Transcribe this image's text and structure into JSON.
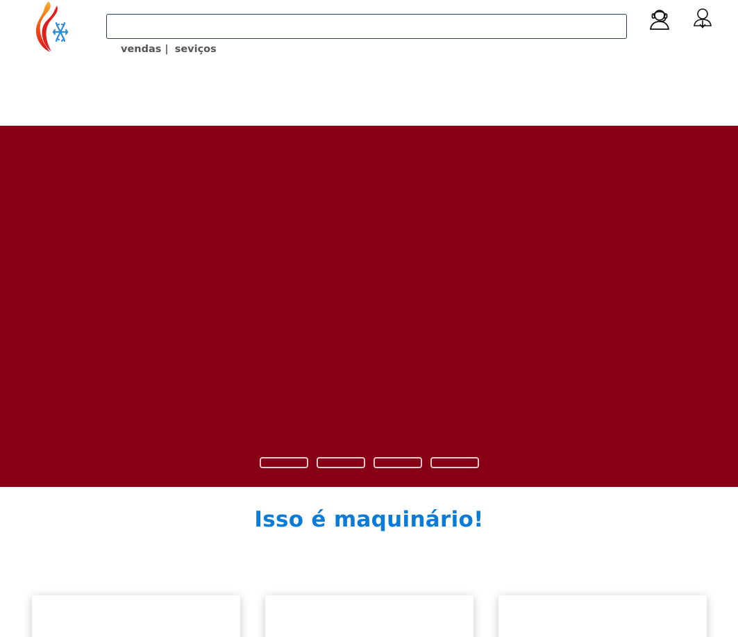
{
  "header": {
    "logo_icon": "flame-snowflake-logo-icon",
    "search": {
      "value": "",
      "placeholder": ""
    },
    "nav": [
      {
        "label": "vendas"
      },
      {
        "label": "seviços"
      }
    ],
    "nav_separator": "|",
    "support_icon": "headset-support-icon",
    "account_icon": "user-account-icon"
  },
  "hero": {
    "background_color": "#870016",
    "slide_indicators": 4
  },
  "section": {
    "title": "Isso é maquinário!",
    "title_color": "#0a7bd6"
  },
  "colors": {
    "accent_blue": "#0a7bd6",
    "hero_red": "#870016",
    "nav_text": "#555555",
    "search_border": "#1d3c6b"
  }
}
